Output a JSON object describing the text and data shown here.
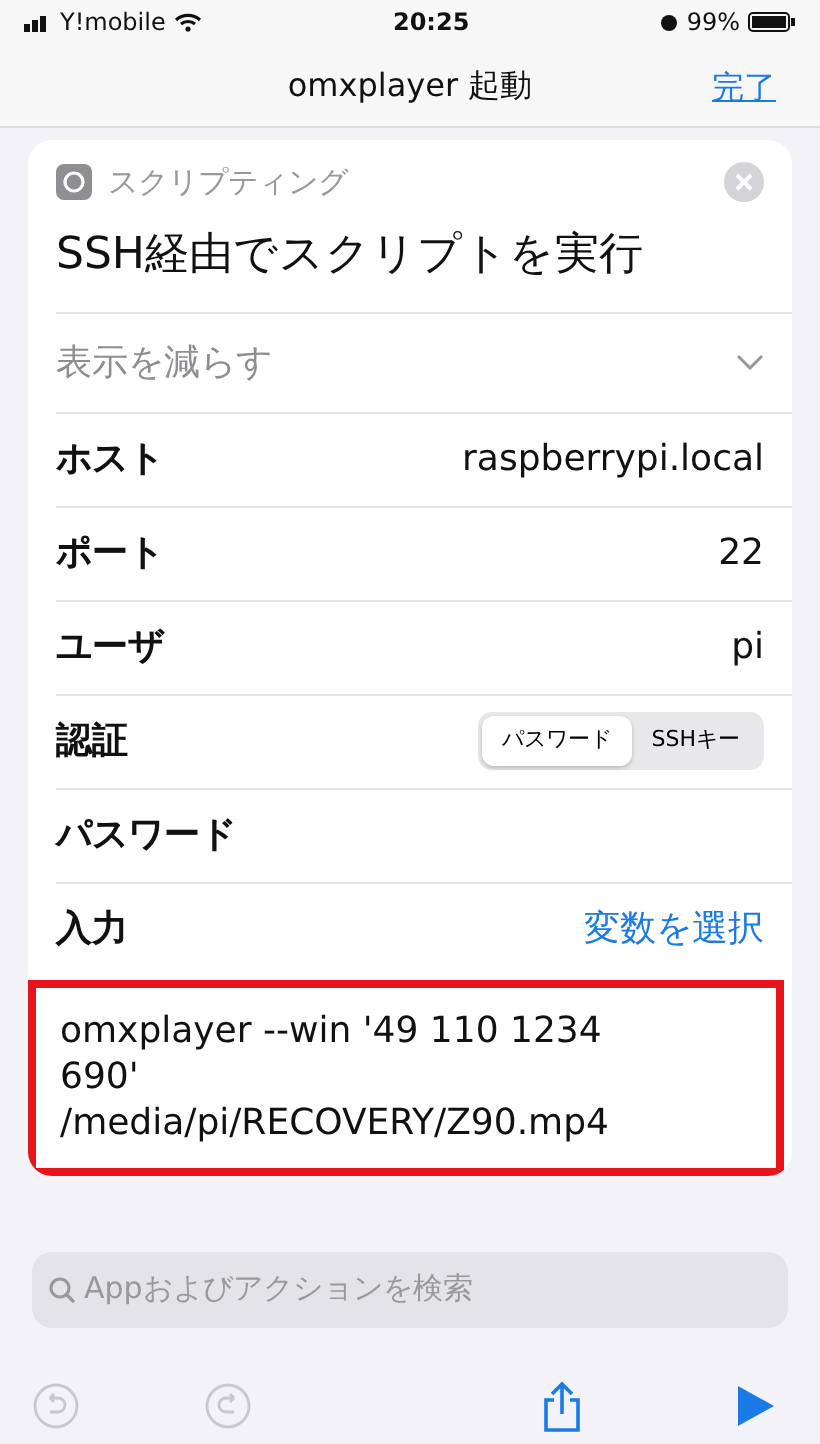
{
  "status_bar": {
    "carrier": "Y!mobile",
    "time": "20:25",
    "battery": "99%"
  },
  "nav": {
    "title": "omxplayer 起動",
    "done": "完了"
  },
  "action": {
    "category": "スクリプティング",
    "title": "SSH経由でスクリプトを実行",
    "show_less": "表示を減らす",
    "fields": [
      {
        "kind": "text",
        "label": "ホスト",
        "value": "raspberrypi.local"
      },
      {
        "kind": "text",
        "label": "ポート",
        "value": "22"
      },
      {
        "kind": "text",
        "label": "ユーザ",
        "value": "pi"
      },
      {
        "kind": "segmented",
        "label": "認証",
        "options": [
          {
            "label": "パスワード",
            "selected": true
          },
          {
            "label": "SSHキー",
            "selected": false
          }
        ]
      },
      {
        "kind": "text",
        "label": "パスワード"
      },
      {
        "kind": "link",
        "label": "入力",
        "value": "変数を選択"
      }
    ],
    "script": {
      "text": "omxplayer --win '49 110 1234 690' /media/pi/RECOVERY/Z90.mp4",
      "highlighted": true
    }
  },
  "search": {
    "placeholder": "Appおよびアクションを検索"
  },
  "toolbar": [
    {
      "kind": "undo",
      "disabled": true
    },
    {
      "kind": "redo",
      "disabled": true
    },
    {
      "kind": "share",
      "disabled": false
    },
    {
      "kind": "play",
      "disabled": false
    }
  ]
}
